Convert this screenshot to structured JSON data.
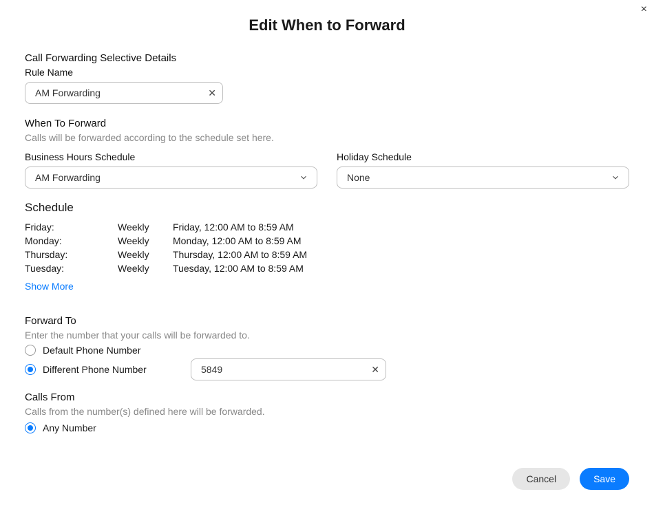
{
  "title": "Edit When to Forward",
  "details_heading": "Call Forwarding Selective Details",
  "rule_name": {
    "label": "Rule Name",
    "value": "AM Forwarding"
  },
  "when_to_forward": {
    "heading": "When To Forward",
    "hint": "Calls will be forwarded according to the schedule set here."
  },
  "business_hours": {
    "label": "Business Hours Schedule",
    "selected": "AM Forwarding"
  },
  "holiday": {
    "label": "Holiday Schedule",
    "selected": "None"
  },
  "schedule": {
    "heading": "Schedule",
    "rows": [
      {
        "day": "Friday:",
        "freq": "Weekly",
        "time": "Friday, 12:00 AM to 8:59 AM"
      },
      {
        "day": "Monday:",
        "freq": "Weekly",
        "time": "Monday, 12:00 AM to 8:59 AM"
      },
      {
        "day": "Thursday:",
        "freq": "Weekly",
        "time": "Thursday, 12:00 AM to 8:59 AM"
      },
      {
        "day": "Tuesday:",
        "freq": "Weekly",
        "time": "Tuesday, 12:00 AM to 8:59 AM"
      }
    ],
    "show_more": "Show More"
  },
  "forward_to": {
    "heading": "Forward To",
    "hint": "Enter the number that your calls will be forwarded to.",
    "options": {
      "default_label": "Default Phone Number",
      "different_label": "Different Phone Number"
    },
    "selected": "different",
    "different_value": "5849"
  },
  "calls_from": {
    "heading": "Calls From",
    "hint": "Calls from the number(s) defined here will be forwarded.",
    "any_label": "Any Number",
    "selected": "any"
  },
  "footer": {
    "cancel": "Cancel",
    "save": "Save"
  }
}
